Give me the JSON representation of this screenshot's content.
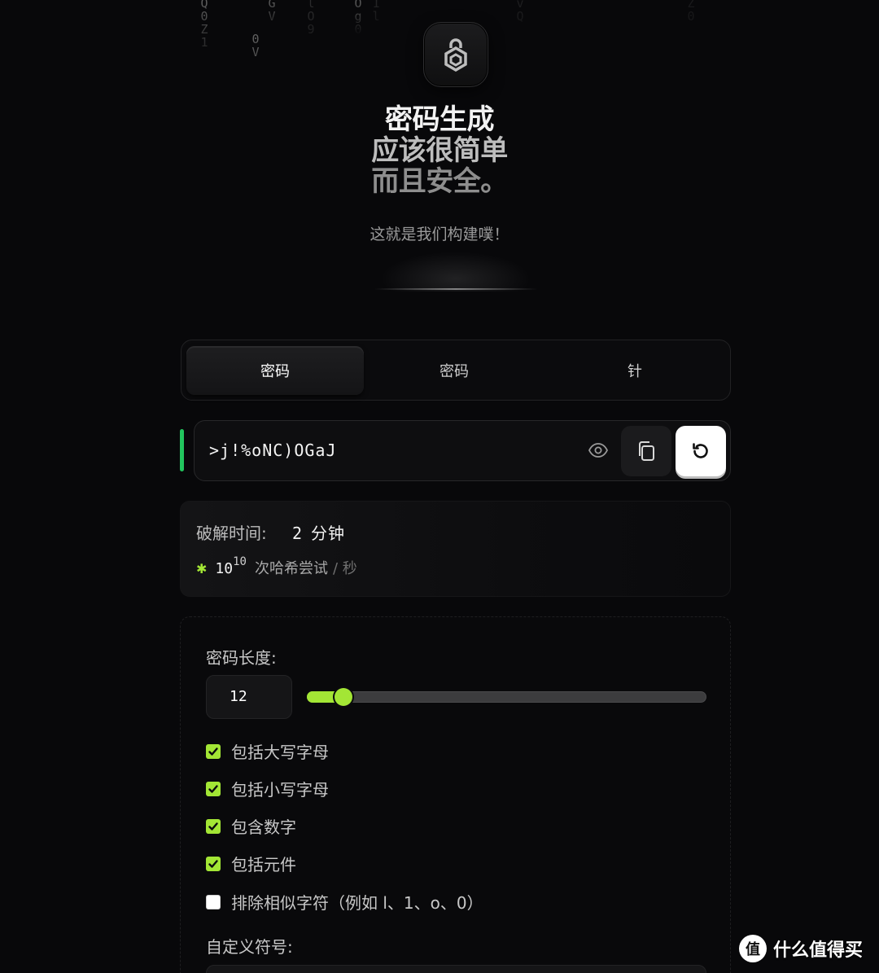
{
  "background_rain": [
    "Q0Z1",
    "GV",
    "Og0v",
    "0V",
    "lO9",
    "vQ",
    "Z0",
    "1l"
  ],
  "brand": {
    "logo_icon": "hexagon-lock-icon"
  },
  "hero": {
    "line1": "密码生成",
    "line2": "应该很简单",
    "line3": "而且安全。",
    "subtitle": "这就是我们构建噗！"
  },
  "tabs": [
    {
      "label": "密码",
      "active": true
    },
    {
      "label": "密码",
      "active": false
    },
    {
      "label": "针",
      "active": false
    }
  ],
  "password": {
    "value": ">j!%oNC)OGaJ",
    "strength_color": "#22c55e",
    "eye_icon": "eye-icon",
    "copy_icon": "copy-icon",
    "regenerate_icon": "refresh-icon"
  },
  "crack": {
    "label": "破解时间:",
    "value_num": "2",
    "value_unit": "分钟",
    "rate_icon": "asterisk-icon",
    "rate_base": "10",
    "rate_exp": "10",
    "rate_unit": "次哈希尝试",
    "rate_per": "/ 秒"
  },
  "settings": {
    "length_label": "密码长度:",
    "length_value": "12",
    "length_slider": {
      "value": 12,
      "min": 8,
      "max": 64,
      "color": "#a3e635"
    },
    "options": [
      {
        "label": "包括大写字母",
        "checked": true
      },
      {
        "label": "包括小写字母",
        "checked": true
      },
      {
        "label": "包含数字",
        "checked": true
      },
      {
        "label": "包括元件",
        "checked": true
      },
      {
        "label": "排除相似字符（例如 l、1、o、0）",
        "checked": false
      }
    ],
    "custom_symbols_label": "自定义符号:"
  },
  "watermark": {
    "icon_text": "值",
    "text": "什么值得买"
  }
}
